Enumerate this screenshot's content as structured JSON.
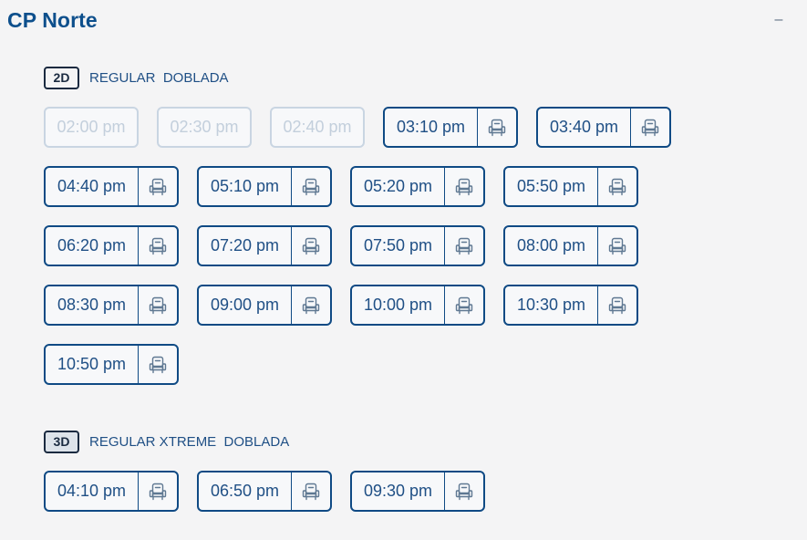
{
  "cinema": {
    "name": "CP Norte",
    "collapse_symbol": "–"
  },
  "sections": [
    {
      "badge": "2D",
      "badge_filled": false,
      "label": "REGULAR  DOBLADA",
      "showtimes": [
        {
          "time": "02:00 pm",
          "available": false
        },
        {
          "time": "02:30 pm",
          "available": false
        },
        {
          "time": "02:40 pm",
          "available": false
        },
        {
          "time": "03:10 pm",
          "available": true
        },
        {
          "time": "03:40 pm",
          "available": true
        },
        {
          "time": "04:40 pm",
          "available": true
        },
        {
          "time": "05:10 pm",
          "available": true
        },
        {
          "time": "05:20 pm",
          "available": true
        },
        {
          "time": "05:50 pm",
          "available": true
        },
        {
          "time": "06:20 pm",
          "available": true
        },
        {
          "time": "07:20 pm",
          "available": true
        },
        {
          "time": "07:50 pm",
          "available": true
        },
        {
          "time": "08:00 pm",
          "available": true
        },
        {
          "time": "08:30 pm",
          "available": true
        },
        {
          "time": "09:00 pm",
          "available": true
        },
        {
          "time": "10:00 pm",
          "available": true
        },
        {
          "time": "10:30 pm",
          "available": true
        },
        {
          "time": "10:50 pm",
          "available": true
        }
      ]
    },
    {
      "badge": "3D",
      "badge_filled": true,
      "label": "REGULAR XTREME  DOBLADA",
      "showtimes": [
        {
          "time": "04:10 pm",
          "available": true
        },
        {
          "time": "06:50 pm",
          "available": true
        },
        {
          "time": "09:30 pm",
          "available": true
        }
      ]
    }
  ],
  "icons": {
    "seat": "seat-icon"
  },
  "colors": {
    "brand": "#0d4f8c",
    "button_border": "#0f4a84",
    "disabled_border": "#c9d5e2",
    "disabled_text": "#c3cfdc",
    "background": "#f4f4f5"
  }
}
